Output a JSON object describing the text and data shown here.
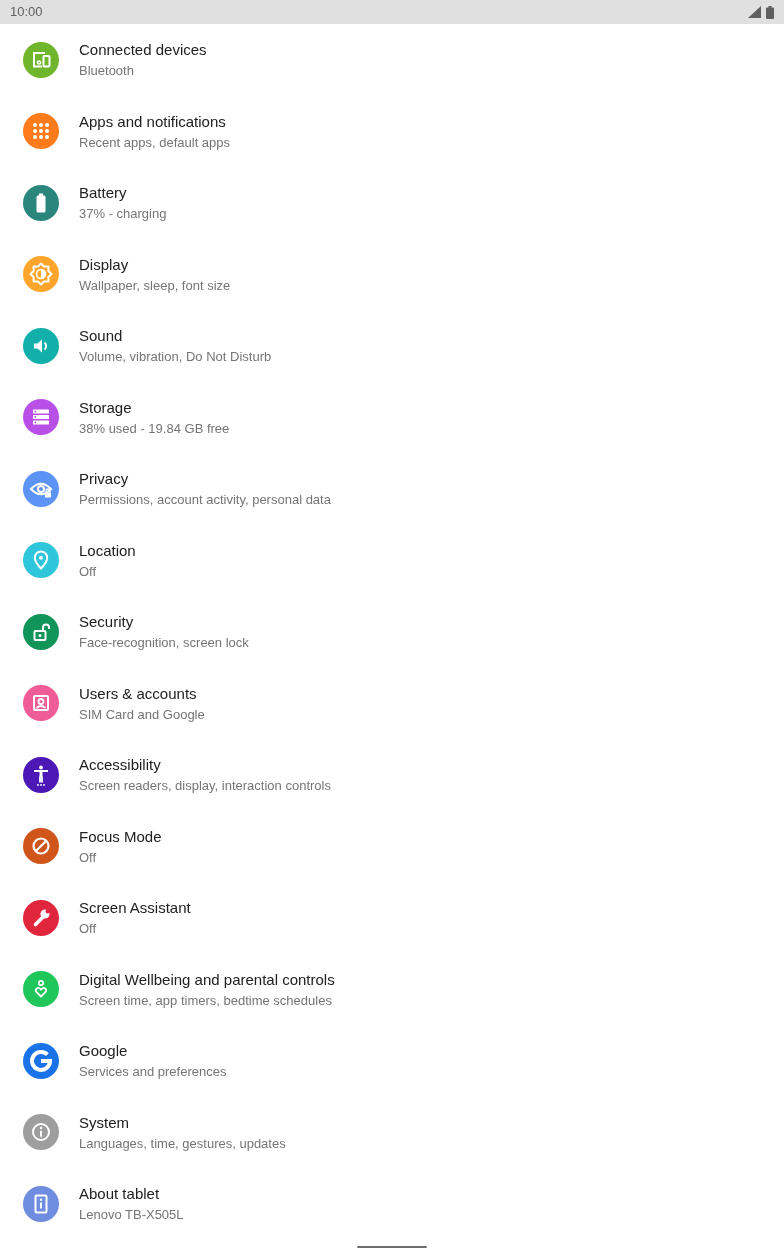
{
  "status_bar": {
    "time": "10:00"
  },
  "settings": [
    {
      "title": "Connected devices",
      "subtitle": "Bluetooth",
      "color": "#70b62c"
    },
    {
      "title": "Apps and notifications",
      "subtitle": "Recent apps, default apps",
      "color": "#ff7b1c"
    },
    {
      "title": "Battery",
      "subtitle": "37% - charging",
      "color": "#2a857c"
    },
    {
      "title": "Display",
      "subtitle": "Wallpaper, sleep, font size",
      "color": "#ffa52b"
    },
    {
      "title": "Sound",
      "subtitle": "Volume, vibration, Do Not Disturb",
      "color": "#13b0ab"
    },
    {
      "title": "Storage",
      "subtitle": "38% used - 19.84 GB free",
      "color": "#b84fe6"
    },
    {
      "title": "Privacy",
      "subtitle": "Permissions, account activity, personal data",
      "color": "#5c94f5"
    },
    {
      "title": "Location",
      "subtitle": "Off",
      "color": "#2fc6dc"
    },
    {
      "title": "Security",
      "subtitle": "Face-recognition, screen lock",
      "color": "#109458"
    },
    {
      "title": "Users & accounts",
      "subtitle": "SIM Card and Google",
      "color": "#ef5c96"
    },
    {
      "title": "Accessibility",
      "subtitle": "Screen readers, display, interaction controls",
      "color": "#4b17b5"
    },
    {
      "title": "Focus Mode",
      "subtitle": "Off",
      "color": "#d0551b"
    },
    {
      "title": "Screen Assistant",
      "subtitle": "Off",
      "color": "#e0263d"
    },
    {
      "title": "Digital Wellbeing and parental controls",
      "subtitle": "Screen time, app timers, bedtime schedules",
      "color": "#1fc75a"
    },
    {
      "title": "Google",
      "subtitle": "Services and preferences",
      "color": "#1a73e8"
    },
    {
      "title": "System",
      "subtitle": "Languages, time, gestures, updates",
      "color": "#9e9e9e"
    },
    {
      "title": "About tablet",
      "subtitle": "Lenovo TB-X505L",
      "color": "#6e8ce0"
    }
  ]
}
